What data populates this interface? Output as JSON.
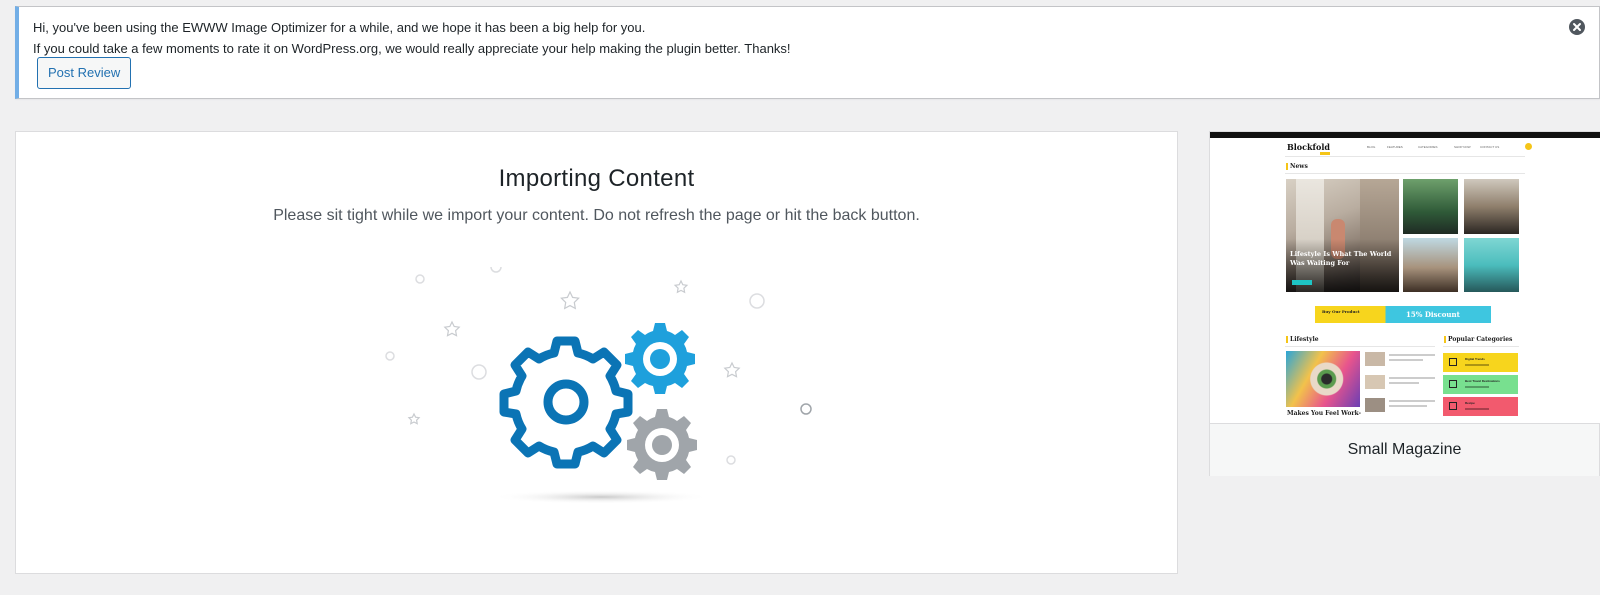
{
  "notice": {
    "line1": "Hi, you've been using the EWWW Image Optimizer for a while, and we hope it has been a big help for you.",
    "line2": "If you could take a few moments to rate it on WordPress.org, we would really appreciate your help making the plugin better. Thanks!",
    "button_label": "Post Review",
    "dismiss_icon": "close-circle-icon"
  },
  "import": {
    "title": "Importing Content",
    "subtitle": "Please sit tight while we import your content. Do not refresh the page or hit the back button.",
    "illustration_icon": "gears-icon"
  },
  "preview": {
    "title": "Small Magazine",
    "site": {
      "logo": "Blockfold",
      "nav": [
        "BLOG",
        "FEATURES",
        "CATEGORIES",
        "SHOP NOW",
        "CONTACT US"
      ],
      "news_heading": "News",
      "hero_title": "Lifestyle Is What The World Was Waiting For",
      "banner_text": "Buy Our Product",
      "banner_discount": "15% Discount",
      "lifestyle_heading": "Lifestyle",
      "lifestyle_card_title": "Makes You Feel Work-",
      "popular_heading": "Popular Categories",
      "categories": [
        "Digital Trends",
        "Best Travel Destinations",
        "Recipe"
      ]
    }
  },
  "colors": {
    "accent": "#72aee6",
    "button_blue": "#2271b1",
    "gear_dark_blue": "#0b74b5",
    "gear_light_blue": "#1ea0dc",
    "gear_gray": "#a0a5aa",
    "cat_yellow": "#f7d51d",
    "cat_green": "#78e08f",
    "cat_red": "#f25a6e"
  }
}
